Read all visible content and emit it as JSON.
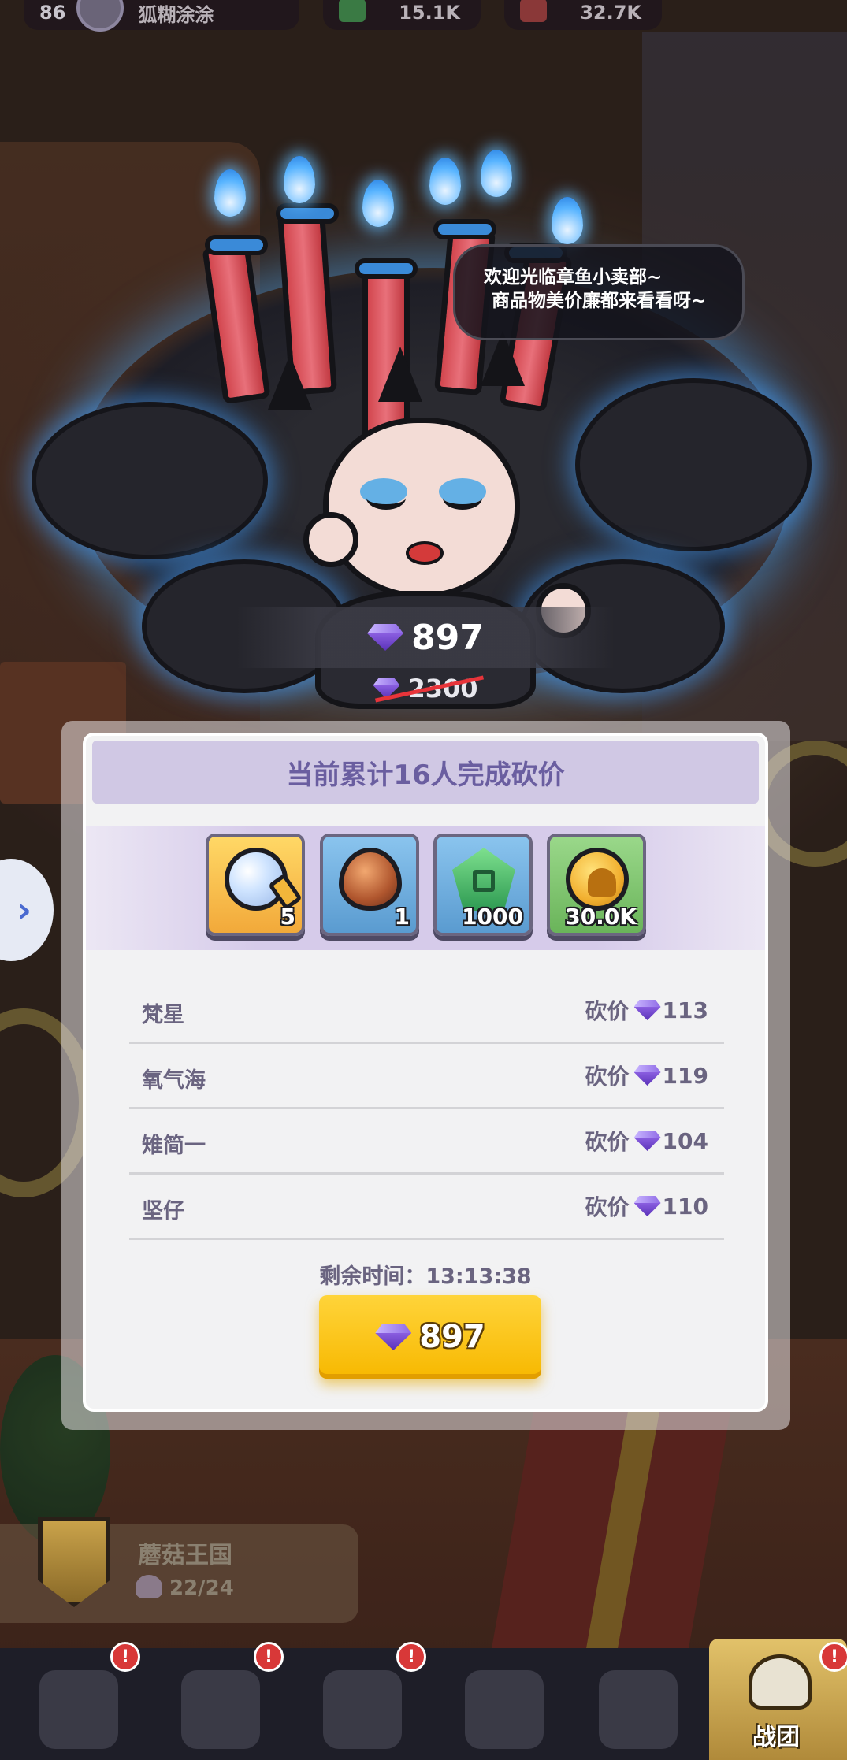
{
  "topbar": {
    "level": "86",
    "player_name": "狐糊涂涂",
    "green_resource": "15.1K",
    "red_resource": "32.7K"
  },
  "shopkeeper": {
    "greeting_line1": "欢迎光临章鱼小卖部~",
    "greeting_line2": "商品物美价廉都来看看呀~"
  },
  "price": {
    "current": "897",
    "original": "2300"
  },
  "panel": {
    "header": "当前累计16人完成砍价",
    "rewards": [
      {
        "icon": "magnifier-icon",
        "qty": "5"
      },
      {
        "icon": "mushroom-egg-icon",
        "qty": "1"
      },
      {
        "icon": "green-gem-icon",
        "qty": "1000"
      },
      {
        "icon": "gold-coin-icon",
        "qty": "30.0K"
      }
    ],
    "bargains": [
      {
        "name": "梵星",
        "label": "砍价",
        "amount": "113"
      },
      {
        "name": "氧气海",
        "label": "砍价",
        "amount": "119"
      },
      {
        "name": "雉简一",
        "label": "砍价",
        "amount": "104"
      },
      {
        "name": "坚仔",
        "label": "砍价",
        "amount": "110"
      }
    ],
    "remaining_time": "剩余时间：13:13:38",
    "buy_price": "897"
  },
  "kingdom": {
    "name": "蘑菇王国",
    "count": "22/24"
  },
  "bottom_nav": {
    "badges": [
      "!",
      "!",
      "!",
      "!"
    ],
    "active_label": "战团"
  },
  "colors": {
    "accent_purple": "#6a5ea0",
    "buy_yellow": "#ffd43a",
    "gem_purple": "#8a5ee0",
    "strike_red": "#e8343a"
  }
}
